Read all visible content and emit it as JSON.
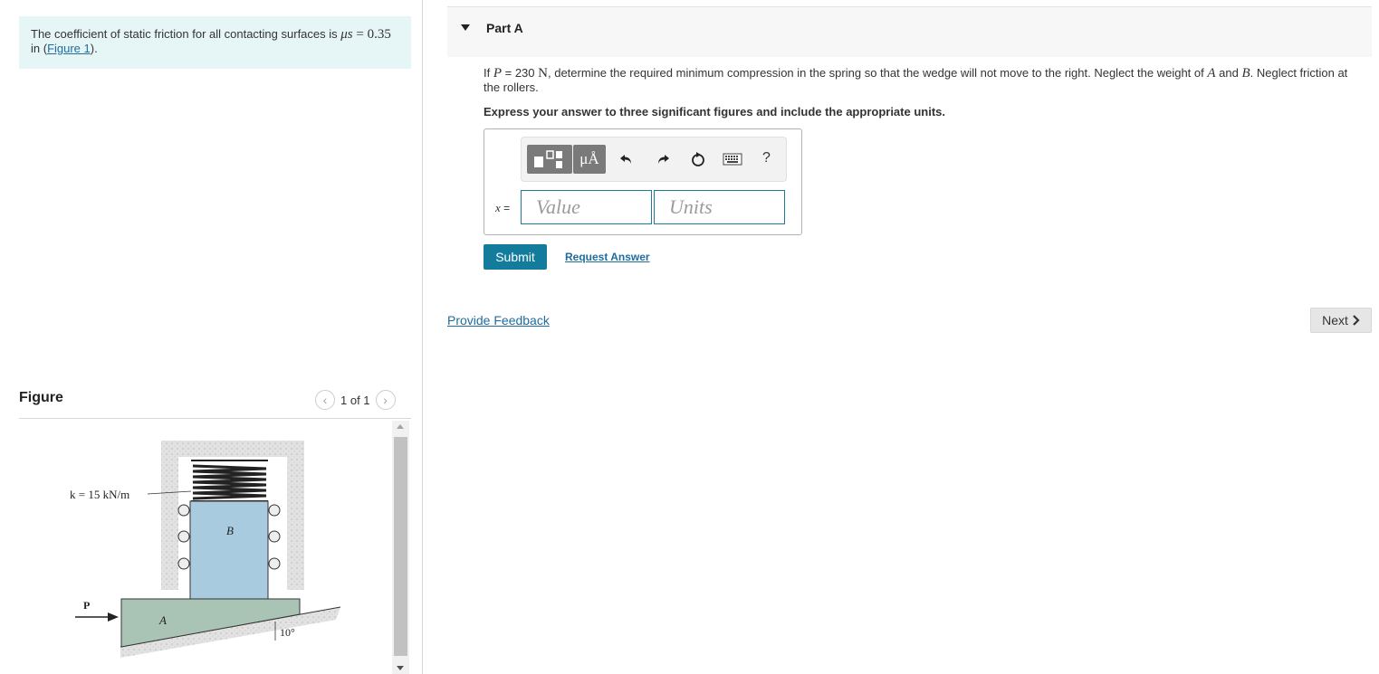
{
  "intro": {
    "text_prefix": "The coefficient of static friction for all contacting surfaces is ",
    "mu_symbol": "μs",
    "mu_value": " = 0.35",
    "text_in": "in (",
    "figure_link": "Figure 1",
    "text_suffix": ")."
  },
  "figure_panel": {
    "title": "Figure",
    "pager_text": "1 of 1",
    "prev_icon": "chevron-left-icon",
    "next_icon": "chevron-right-icon",
    "diagram": {
      "spring_label": "k = 15 kN/m",
      "force_label": "P",
      "block_a_label": "A",
      "block_b_label": "B",
      "angle_label": "10°",
      "colors": {
        "block_a": "#a9c3b4",
        "block_b": "#a9cbe0",
        "wall": "#dcdcdc"
      }
    }
  },
  "part": {
    "title": "Part A",
    "question_prefix": "If ",
    "P_symbol": "P",
    "question_value": " = 230 ",
    "question_unit": "N",
    "question_mid": ", determine the required minimum compression in the spring so that the wedge will not move to the right. Neglect the weight of ",
    "A_symbol": "A",
    "question_and": " and ",
    "B_symbol": "B",
    "question_end": ". Neglect friction at the rollers.",
    "instruction": "Express your answer to three significant figures and include the appropriate units.",
    "toolbar": {
      "mu_button": "μÅ",
      "help": "?",
      "icons": [
        "templates-icon",
        "undo-icon",
        "redo-icon",
        "reset-icon",
        "keyboard-icon"
      ]
    },
    "x_label": "x",
    "equals": " =",
    "value_placeholder": "Value",
    "units_placeholder": "Units",
    "submit_label": "Submit",
    "request_answer_label": "Request Answer"
  },
  "footer": {
    "feedback_label": "Provide Feedback",
    "next_label": "Next"
  },
  "colors": {
    "accent": "#137b9b",
    "link": "#1f6c9f",
    "intro_bg": "#e6f6f7"
  }
}
